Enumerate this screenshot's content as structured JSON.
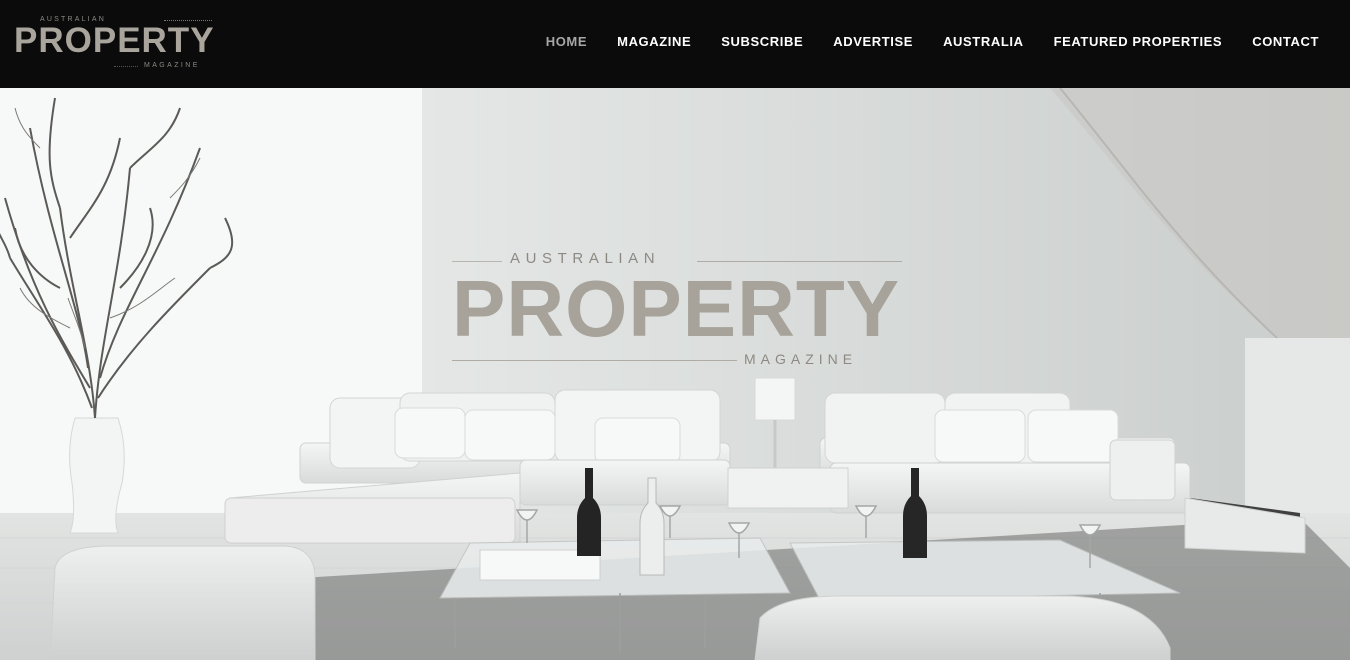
{
  "header": {
    "logo": {
      "top_word": "AUSTRALIAN",
      "main_word": "PROPERTY",
      "bottom_word": "MAGAZINE"
    },
    "nav": [
      {
        "label": "HOME",
        "active": true
      },
      {
        "label": "MAGAZINE",
        "active": false
      },
      {
        "label": "SUBSCRIBE",
        "active": false
      },
      {
        "label": "ADVERTISE",
        "active": false
      },
      {
        "label": "AUSTRALIA",
        "active": false
      },
      {
        "label": "FEATURED PROPERTIES",
        "active": false
      },
      {
        "label": "CONTACT",
        "active": false
      }
    ]
  },
  "hero": {
    "logo": {
      "top_word": "AUSTRALIAN",
      "main_word": "PROPERTY",
      "bottom_word": "MAGAZINE"
    },
    "image": "white-living-room-interior"
  },
  "colors": {
    "header_bg": "#0b0b0b",
    "nav_text": "#ffffff",
    "nav_active": "#a7a7a7",
    "logo_gray": "#a9a59d"
  }
}
